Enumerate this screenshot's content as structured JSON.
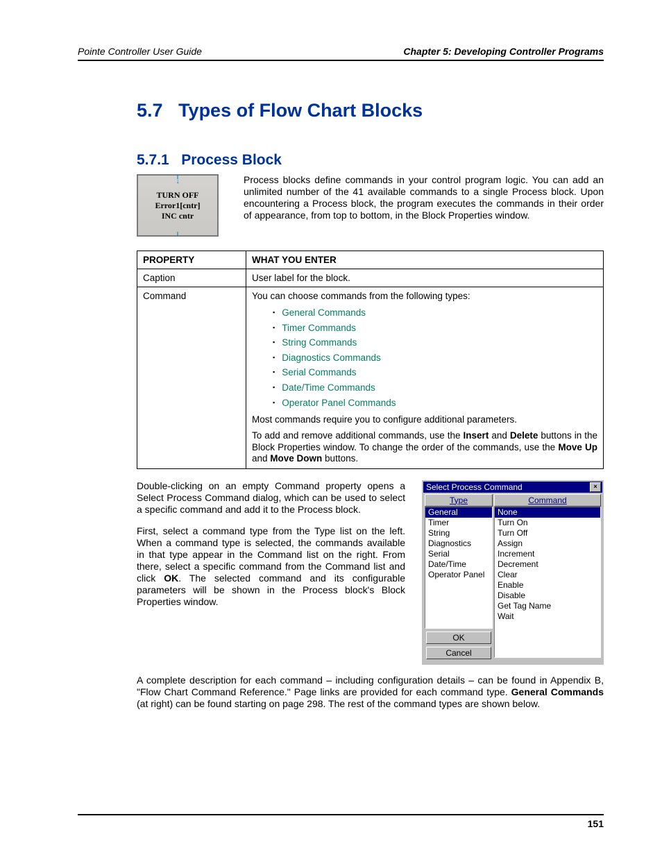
{
  "header": {
    "left": "Pointe Controller User Guide",
    "right": "Chapter 5: Developing Controller Programs"
  },
  "section": {
    "num": "5.7",
    "title": "Types of Flow Chart Blocks"
  },
  "subsection": {
    "num": "5.7.1",
    "title": "Process Block"
  },
  "block_fig": {
    "line1": "TURN OFF",
    "line2": "Error1[cntr]",
    "line3": "INC cntr"
  },
  "intro": "Process blocks define commands in your control program logic. You can add an unlimited number of the 41 available commands to a single Process block. Upon encountering a Process block, the program executes the commands in their order of appearance, from top to bottom, in the Block Properties window.",
  "table": {
    "h_property": "PROPERTY",
    "h_what": "WHAT YOU ENTER",
    "caption_label": "Caption",
    "caption_val": "User label for the block.",
    "command_label": "Command",
    "command_intro": "You can choose commands from the following types:",
    "types": [
      "General Commands",
      "Timer Commands",
      "String Commands",
      "Diagnostics Commands",
      "Serial Commands",
      "Date/Time Commands",
      "Operator Panel Commands"
    ],
    "command_mid": "Most commands require you to configure additional parameters.",
    "cmd_end": {
      "p1a": "To add and remove additional commands, use the ",
      "b1": "Insert",
      "p1b": " and ",
      "b2": "Delete",
      "p1c": " buttons in the Block Properties window. To change the order of the commands, use the ",
      "b3": "Move Up",
      "p1d": " and ",
      "b4": "Move Down",
      "p1e": " buttons."
    }
  },
  "body2a": "Double-clicking on an empty Command property opens a Select Process Command dialog, which can be used to select a specific command and add it to the Process block.",
  "body2b_parts": {
    "a": "First, select a command type from the Type list on the left. When a command type is selected, the commands available in that type appear in the Command list on the right. From there, select a specific command from the Command list and click ",
    "ok": "OK",
    "b": ". The selected command and its configurable parameters will be shown in the Process block's Block Properties window."
  },
  "body3_parts": {
    "a": "A complete description for each command – including configuration details – can be found in Appendix B, \"Flow Chart Command Reference.\" Page links are provided for each command type. ",
    "b1": "General Commands",
    "b": " (at right) can be found starting on page 298. The rest of the command types are shown below."
  },
  "dialog": {
    "title": "Select Process Command",
    "type_header": "Type",
    "cmd_header": "Command",
    "types": [
      "General",
      "Timer",
      "String",
      "Diagnostics",
      "Serial",
      "Date/Time",
      "Operator Panel"
    ],
    "type_selected": 0,
    "commands": [
      "None",
      "Turn On",
      "Turn Off",
      "Assign",
      "Increment",
      "Decrement",
      "Clear",
      "Enable",
      "Disable",
      "Get Tag Name",
      "Wait"
    ],
    "cmd_selected": 0,
    "ok": "OK",
    "cancel": "Cancel"
  },
  "page_num": "151"
}
